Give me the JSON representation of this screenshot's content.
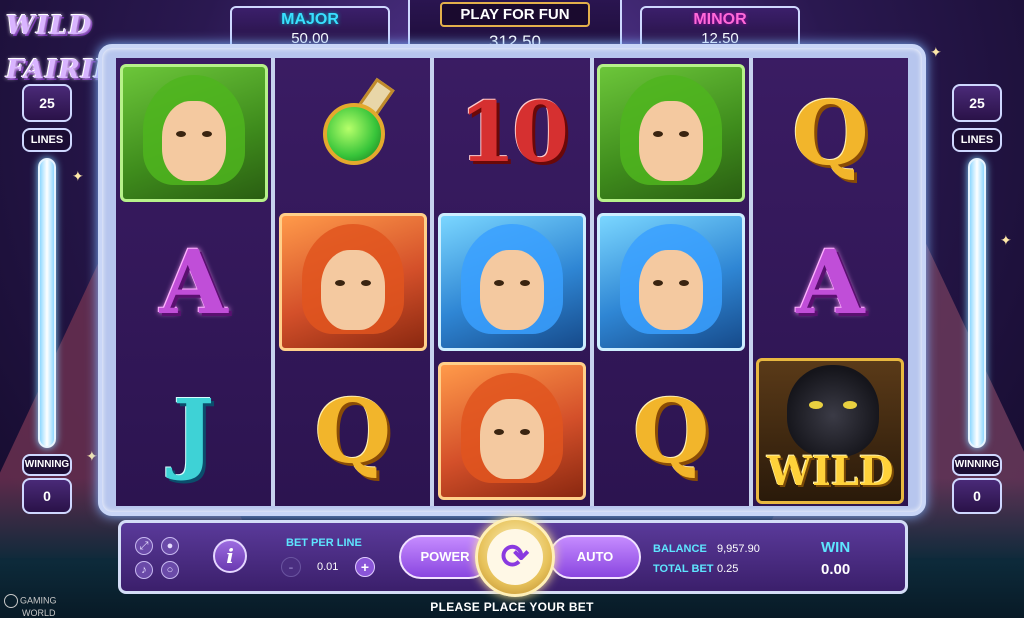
{
  "game": {
    "logo": "WILD FAIRIES"
  },
  "jackpots": {
    "major_label": "MAJOR",
    "major_value": "50.00",
    "play_mode": "PLAY FOR FUN",
    "center_value": "312.50",
    "minor_label": "MINOR",
    "minor_value": "12.50"
  },
  "reels": [
    [
      "fairy-green",
      "A",
      "J"
    ],
    [
      "potion",
      "fairy-red",
      "Q"
    ],
    [
      "10",
      "fairy-blue",
      "fairy-red"
    ],
    [
      "fairy-green",
      "fairy-blue",
      "Q"
    ],
    [
      "Q",
      "A",
      "wild-panther"
    ]
  ],
  "symbols": {
    "A": "A",
    "J": "J",
    "Q": "Q",
    "ten": "10",
    "wild": "WILD"
  },
  "side_left": {
    "lines_value": "25",
    "lines_label": "LINES",
    "winning_label": "WINNING",
    "winning_value": "0"
  },
  "side_right": {
    "lines_value": "25",
    "lines_label": "LINES",
    "winning_label": "WINNING",
    "winning_value": "0"
  },
  "panel": {
    "info_icon": "i",
    "bet_per_line_label": "BET PER LINE",
    "bet_per_line_value": "0.01",
    "minus": "-",
    "plus": "+",
    "power_label": "POWER",
    "auto_label": "AUTO",
    "spin_icon": "⟳",
    "balance_label": "BALANCE",
    "balance_value": "9,957.90",
    "total_bet_label": "TOTAL BET",
    "total_bet_value": "0.25",
    "win_label": "WIN",
    "win_value": "0.00"
  },
  "status": {
    "message": "PLEASE PLACE YOUR BET"
  },
  "brand": {
    "line1": "GAMING",
    "line2": "WORLD"
  },
  "colors": {
    "accent_cyan": "#5ee6ff",
    "accent_pink": "#ff6ad8",
    "frame": "#c9d6f7",
    "panel": "#3b1f6b"
  }
}
